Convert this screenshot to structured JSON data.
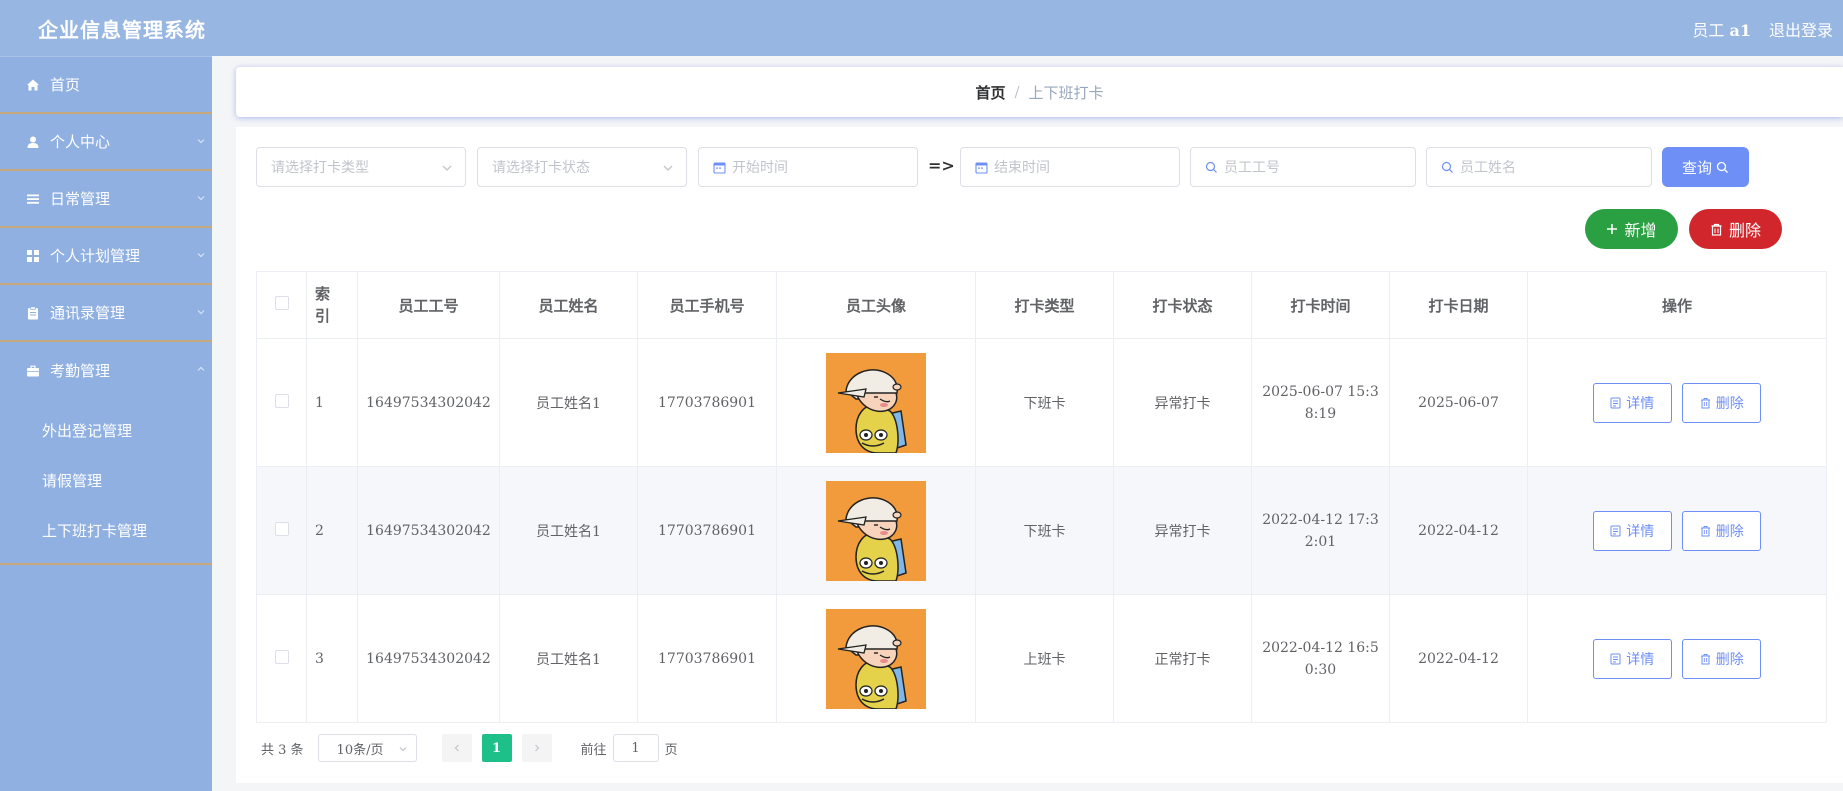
{
  "header": {
    "title": "企业信息管理系统",
    "user_prefix": "员工",
    "user_name": "a1",
    "logout": "退出登录"
  },
  "sidebar": {
    "items": [
      {
        "label": "首页",
        "icon": "home-icon"
      },
      {
        "label": "个人中心",
        "icon": "user-icon"
      },
      {
        "label": "日常管理",
        "icon": "menu-icon"
      },
      {
        "label": "个人计划管理",
        "icon": "grid-icon"
      },
      {
        "label": "通讯录管理",
        "icon": "clipboard-icon"
      },
      {
        "label": "考勤管理",
        "icon": "briefcase-icon"
      }
    ],
    "sub_items": [
      "外出登记管理",
      "请假管理",
      "上下班打卡管理"
    ]
  },
  "breadcrumb": {
    "home": "首页",
    "separator": "/",
    "current": "上下班打卡"
  },
  "filters": {
    "type_placeholder": "请选择打卡类型",
    "status_placeholder": "请选择打卡状态",
    "start_placeholder": "开始时间",
    "range_separator": "=>",
    "end_placeholder": "结束时间",
    "emp_no_placeholder": "员工工号",
    "emp_name_placeholder": "员工姓名",
    "query_label": "查询"
  },
  "actions": {
    "add_label": "新增",
    "delete_label": "删除"
  },
  "table": {
    "headers": [
      "索引",
      "员工工号",
      "员工姓名",
      "员工手机号",
      "员工头像",
      "打卡类型",
      "打卡状态",
      "打卡时间",
      "打卡日期",
      "操作"
    ],
    "rows": [
      {
        "index": "1",
        "emp_no": "16497534302042",
        "emp_name": "员工姓名1",
        "phone": "17703786901",
        "type": "下班卡",
        "status": "异常打卡",
        "time": "2025-06-07 15:38:19",
        "date": "2025-06-07"
      },
      {
        "index": "2",
        "emp_no": "16497534302042",
        "emp_name": "员工姓名1",
        "phone": "17703786901",
        "type": "下班卡",
        "status": "异常打卡",
        "time": "2022-04-12 17:32:01",
        "date": "2022-04-12"
      },
      {
        "index": "3",
        "emp_no": "16497534302042",
        "emp_name": "员工姓名1",
        "phone": "17703786901",
        "type": "上班卡",
        "status": "正常打卡",
        "time": "2022-04-12 16:50:30",
        "date": "2022-04-12"
      }
    ],
    "detail_label": "详情",
    "row_delete_label": "删除"
  },
  "pagination": {
    "total": "共 3 条",
    "page_size": "10条/页",
    "current_page": "1",
    "goto_prefix": "前往",
    "goto_value": "1",
    "goto_suffix": "页"
  },
  "colors": {
    "header_bg": "#97b6e1",
    "sidebar_bg": "#8fb0e0",
    "accent": "#6e8ff5",
    "add_green": "#2aa042",
    "delete_red": "#d0262c",
    "page_active": "#1ec08a"
  }
}
